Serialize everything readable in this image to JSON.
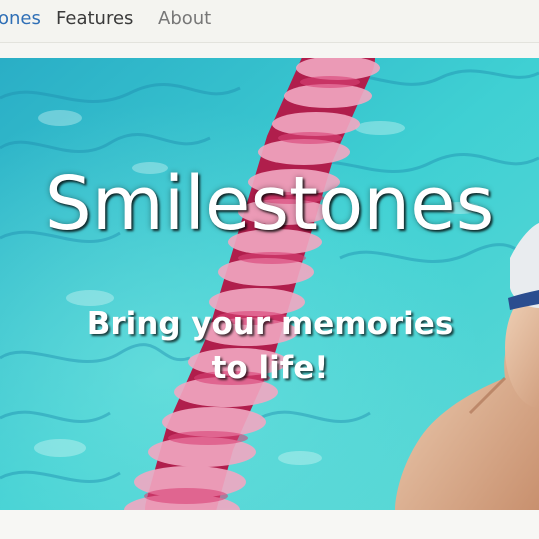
{
  "nav": {
    "items": [
      {
        "label": "ones",
        "active": true
      },
      {
        "label": "Features",
        "active": false
      },
      {
        "label": "About",
        "active": false
      }
    ]
  },
  "hero": {
    "title": "Smilestones",
    "tagline_line1": "Bring your memories",
    "tagline_line2": "to life!",
    "image_description": "swimming-pool-photo"
  },
  "colors": {
    "nav_active": "#2f6fb6",
    "pool_water": "#33c4cf",
    "lane_rope": "#c0285a"
  }
}
